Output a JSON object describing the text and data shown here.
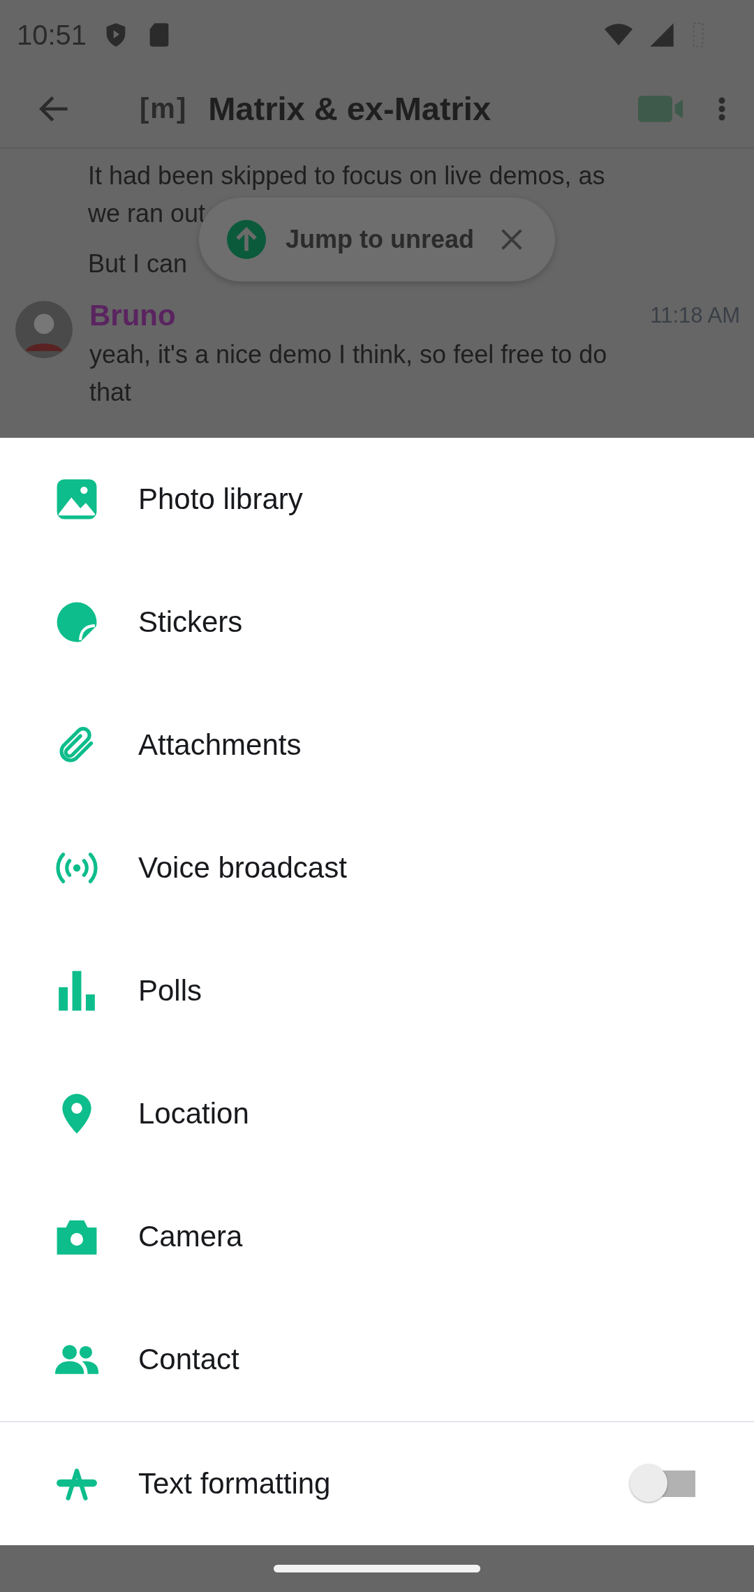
{
  "status_bar": {
    "time": "10:51"
  },
  "toolbar": {
    "title": "Matrix & ex-Matrix",
    "room_badge": "[m]"
  },
  "messages": [
    {
      "kind": "continuation",
      "lines": [
        "It had been skipped to focus on live demos, as",
        "we ran out",
        "But I can"
      ]
    },
    {
      "kind": "message",
      "sender": "Bruno",
      "time": "11:18 AM",
      "lines": [
        "yeah, it's a nice demo I think, so feel free to do",
        "that"
      ]
    }
  ],
  "jump_pill": {
    "label": "Jump to unread"
  },
  "sheet": {
    "items": [
      {
        "kind": "photo",
        "label": "Photo library"
      },
      {
        "kind": "sticker",
        "label": "Stickers"
      },
      {
        "kind": "clip",
        "label": "Attachments"
      },
      {
        "kind": "broadcast",
        "label": "Voice broadcast"
      },
      {
        "kind": "poll",
        "label": "Polls"
      },
      {
        "kind": "location",
        "label": "Location"
      },
      {
        "kind": "camera",
        "label": "Camera"
      },
      {
        "kind": "contact",
        "label": "Contact"
      }
    ],
    "toggle": {
      "label": "Text formatting",
      "on": false
    }
  }
}
